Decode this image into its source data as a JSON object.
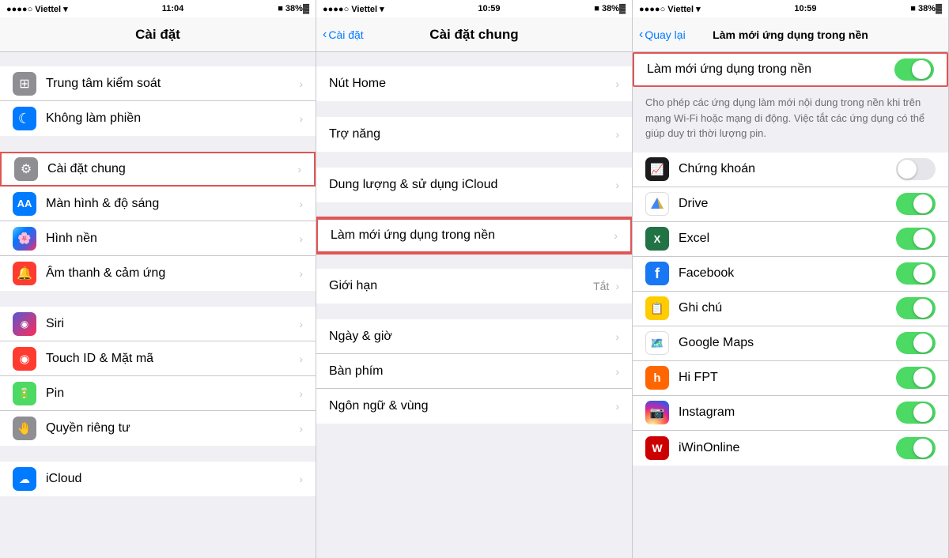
{
  "panel1": {
    "statusBar": {
      "signal": "●●●●○ Viettel ▾",
      "time": "11:04",
      "battery": "■ 38%▓"
    },
    "navTitle": "Cài đặt",
    "items": [
      {
        "id": "control-center",
        "icon": "⊞",
        "iconClass": "icon-gray",
        "label": "Trung tâm kiểm soát",
        "hasChevron": true
      },
      {
        "id": "do-not-disturb",
        "icon": "☾",
        "iconClass": "icon-blue",
        "label": "Không làm phiền",
        "hasChevron": true
      },
      {
        "id": "general",
        "icon": "⚙",
        "iconClass": "icon-gray",
        "label": "Cài đặt chung",
        "hasChevron": true,
        "highlighted": true
      },
      {
        "id": "display",
        "icon": "AA",
        "iconClass": "icon-blue",
        "label": "Màn hình & độ sáng",
        "hasChevron": true
      },
      {
        "id": "wallpaper",
        "icon": "✿",
        "iconClass": "icon-teal",
        "label": "Hình nền",
        "hasChevron": true
      },
      {
        "id": "sounds",
        "icon": "♪",
        "iconClass": "icon-red",
        "label": "Âm thanh & cảm ứng",
        "hasChevron": true
      },
      {
        "id": "siri",
        "icon": "◉",
        "iconClass": "icon-purple",
        "label": "Siri",
        "hasChevron": true
      },
      {
        "id": "touchid",
        "icon": "◉",
        "iconClass": "icon-red",
        "label": "Touch ID & Mặt mã",
        "hasChevron": true
      },
      {
        "id": "battery",
        "icon": "▬",
        "iconClass": "icon-green",
        "label": "Pin",
        "hasChevron": true
      },
      {
        "id": "privacy",
        "icon": "👤",
        "iconClass": "icon-gray",
        "label": "Quyền riêng tư",
        "hasChevron": true
      },
      {
        "id": "icloud",
        "icon": "☁",
        "iconClass": "icon-blue",
        "label": "iCloud",
        "hasChevron": true
      }
    ]
  },
  "panel2": {
    "statusBar": {
      "signal": "●●●●○ Viettel ▾",
      "time": "10:59",
      "battery": "■ 38%▓"
    },
    "navBack": "Cài đặt",
    "navTitle": "Cài đặt chung",
    "items": [
      {
        "id": "nut-home",
        "label": "Nút Home",
        "hasChevron": true
      },
      {
        "id": "tro-nang",
        "label": "Trợ năng",
        "hasChevron": true
      },
      {
        "id": "dung-luong",
        "label": "Dung lượng & sử dụng iCloud",
        "hasChevron": true
      },
      {
        "id": "lam-moi",
        "label": "Làm mới ứng dụng trong nền",
        "hasChevron": true,
        "highlighted": true
      },
      {
        "id": "gioi-han",
        "label": "Giới hạn",
        "value": "Tắt",
        "hasChevron": true
      },
      {
        "id": "ngay-gio",
        "label": "Ngày & giờ",
        "hasChevron": true
      },
      {
        "id": "ban-phim",
        "label": "Bàn phím",
        "hasChevron": true
      },
      {
        "id": "ngon-ngu",
        "label": "Ngôn ngữ & vùng",
        "hasChevron": true
      }
    ]
  },
  "panel3": {
    "statusBar": {
      "signal": "●●●●○ Viettel ▾",
      "time": "10:59",
      "battery": "■ 38%▓"
    },
    "navBack": "Quay lại",
    "navTitle": "Làm mới ứng dụng trong nền",
    "mainToggleLabel": "Làm mới ứng dụng trong nền",
    "mainToggleOn": true,
    "description": "Cho phép các ứng dụng làm mới nội dung trong nền khi trên mạng Wi-Fi hoặc mạng di động. Việc tắt các ứng dụng có thể giúp duy trì thời lượng pin.",
    "apps": [
      {
        "id": "chung-khoan",
        "icon": "📈",
        "iconBg": "#1c1c1e",
        "label": "Chứng khoán",
        "on": false
      },
      {
        "id": "drive",
        "icon": "△",
        "iconBg": "#4285f4",
        "label": "Drive",
        "on": true
      },
      {
        "id": "excel",
        "icon": "⊞",
        "iconBg": "#217346",
        "label": "Excel",
        "on": true
      },
      {
        "id": "facebook",
        "icon": "f",
        "iconBg": "#1877f2",
        "label": "Facebook",
        "on": true
      },
      {
        "id": "ghi-chu",
        "icon": "📝",
        "iconBg": "#ffcc00",
        "label": "Ghi chú",
        "on": true
      },
      {
        "id": "google-maps",
        "icon": "◎",
        "iconBg": "#4285f4",
        "label": "Google Maps",
        "on": true
      },
      {
        "id": "hi-fpt",
        "icon": "h",
        "iconBg": "#ff6600",
        "label": "Hi FPT",
        "on": true
      },
      {
        "id": "instagram",
        "icon": "◉",
        "iconBg": "#c13584",
        "label": "Instagram",
        "on": true
      },
      {
        "id": "iwinonline",
        "icon": "W",
        "iconBg": "#cc0000",
        "label": "iWinOnline",
        "on": true
      }
    ]
  }
}
